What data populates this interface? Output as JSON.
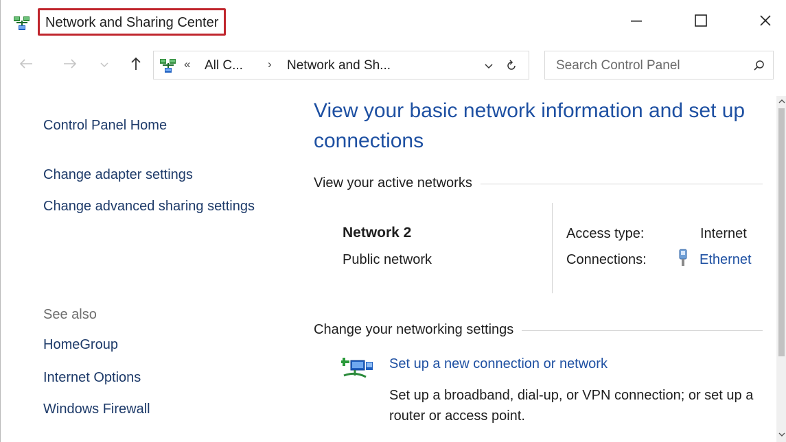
{
  "window": {
    "title": "Network and Sharing Center",
    "icon": "network-center-icon",
    "controls": {
      "minimize_icon": "minimize-icon",
      "maximize_icon": "maximize-icon",
      "close_icon": "close-icon"
    }
  },
  "address_bar": {
    "overflow": "«",
    "crumbs": [
      "All C...",
      "Network and Sh..."
    ],
    "separator": "›",
    "search_placeholder": "Search Control Panel"
  },
  "sidebar": {
    "links": [
      "Control Panel Home",
      "Change adapter settings",
      "Change advanced sharing settings"
    ],
    "see_also_title": "See also",
    "see_also": [
      "HomeGroup",
      "Internet Options",
      "Windows Firewall"
    ]
  },
  "main": {
    "heading": "View your basic network information and set up connections",
    "active_networks_title": "View your active networks",
    "network": {
      "name": "Network  2",
      "category": "Public network",
      "access_type_label": "Access type:",
      "access_type_value": "Internet",
      "connections_label": "Connections:",
      "connection_name": "Ethernet"
    },
    "change_settings_title": "Change your networking settings",
    "task": {
      "title": "Set up a new connection or network",
      "description": "Set up a broadband, dial-up, or VPN connection; or set up a router or access point."
    }
  },
  "colors": {
    "link": "#1d3a69",
    "accent": "#1e50a2",
    "highlight_border": "#c0262d",
    "see_also": "#6d6d6d"
  }
}
